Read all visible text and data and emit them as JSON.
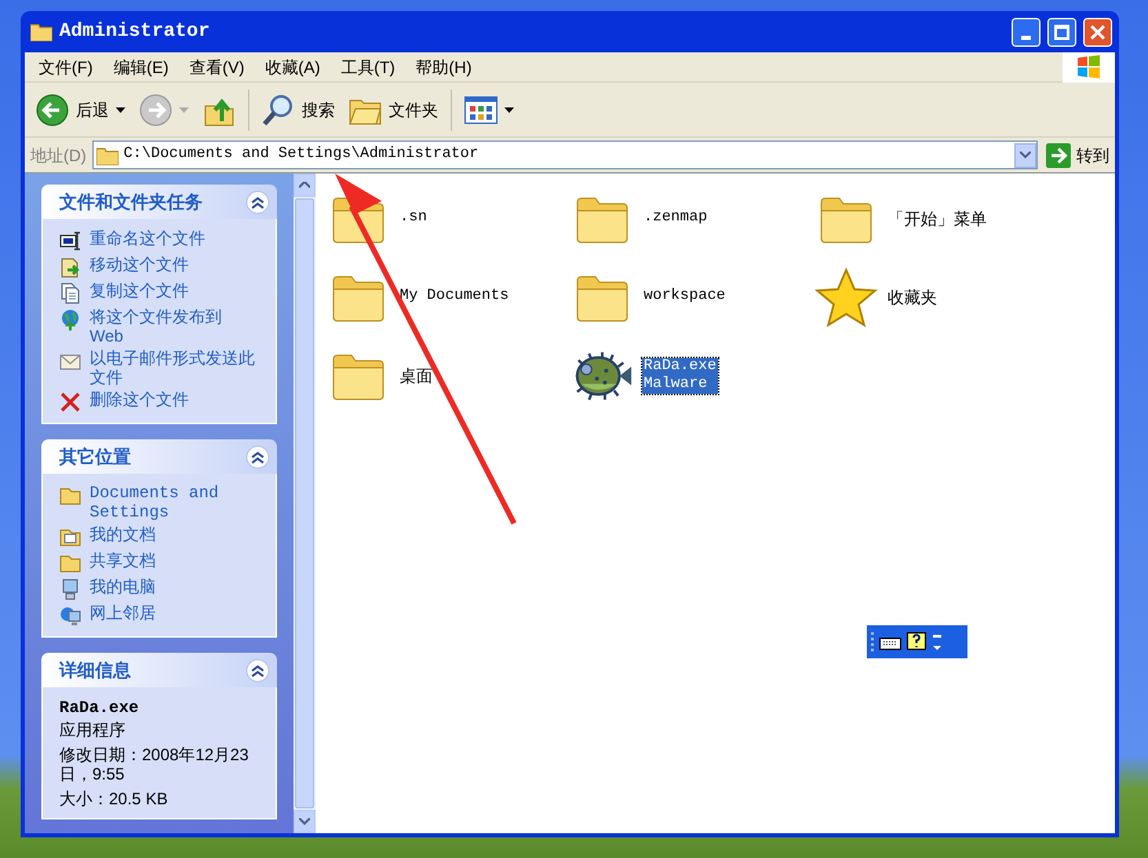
{
  "window": {
    "title": "Administrator"
  },
  "menu": [
    "文件(F)",
    "编辑(E)",
    "查看(V)",
    "收藏(A)",
    "工具(T)",
    "帮助(H)"
  ],
  "toolbar": [
    {
      "kind": "back",
      "label": "后退"
    },
    {
      "kind": "forward"
    },
    {
      "kind": "up"
    },
    {
      "kind": "search",
      "label": "搜索"
    },
    {
      "kind": "folders",
      "label": "文件夹"
    },
    {
      "kind": "views"
    }
  ],
  "address": {
    "label": "地址(D)",
    "value": "C:\\Documents and Settings\\Administrator",
    "go": "转到"
  },
  "panels": [
    {
      "title": "文件和文件夹任务",
      "items": [
        {
          "kind": "rename",
          "label": "重命名这个文件"
        },
        {
          "kind": "move",
          "label": "移动这个文件"
        },
        {
          "kind": "copy",
          "label": "复制这个文件"
        },
        {
          "kind": "publish",
          "label": "将这个文件发布到 Web"
        },
        {
          "kind": "email",
          "label": "以电子邮件形式发送此文件"
        },
        {
          "kind": "delete",
          "label": "删除这个文件"
        }
      ]
    },
    {
      "title": "其它位置",
      "items": [
        {
          "kind": "folder",
          "label": "Documents and Settings"
        },
        {
          "kind": "documents",
          "label": "我的文档"
        },
        {
          "kind": "folder",
          "label": "共享文档"
        },
        {
          "kind": "computer",
          "label": "我的电脑"
        },
        {
          "kind": "network",
          "label": "网上邻居"
        }
      ]
    },
    {
      "title": "详细信息",
      "details": {
        "name": "RaDa.exe",
        "type": "应用程序",
        "modified": "修改日期：2008年12月23日，9:55",
        "size": "大小：20.5 KB"
      }
    }
  ],
  "files": [
    {
      "kind": "folder",
      "name": ".sn",
      "selected": false
    },
    {
      "kind": "folder",
      "name": ".zenmap",
      "selected": false
    },
    {
      "kind": "folder",
      "name": "「开始」菜单",
      "selected": false
    },
    {
      "kind": "folder",
      "name": "My Documents",
      "selected": false
    },
    {
      "kind": "folder",
      "name": "workspace",
      "selected": false
    },
    {
      "kind": "favorites",
      "name": "收藏夹",
      "selected": false
    },
    {
      "kind": "folder",
      "name": "桌面",
      "selected": false
    },
    {
      "kind": "program",
      "name": "RaDa.exe",
      "description": "Malware",
      "selected": true
    }
  ]
}
